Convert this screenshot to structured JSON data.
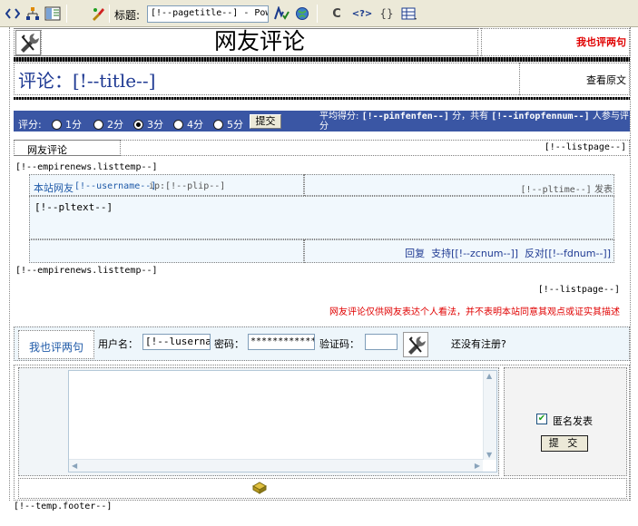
{
  "toolbar": {
    "title_label": "标题:",
    "title_value": "[!--pagetitle--] - Powere",
    "icons": [
      "code-view-icon",
      "tree-icon",
      "layout-icon",
      "paint-icon",
      "validate-icon",
      "globe-icon",
      "refresh-icon",
      "tag-icon",
      "braces-icon",
      "table-icon"
    ],
    "refresh_glyph": "C",
    "tag_glyph": "<?>",
    "braces_glyph": "{}"
  },
  "header": {
    "heading": "网友评论",
    "post_link": "我也评两句"
  },
  "title_row": {
    "comment_title": "评论：[!--title--]",
    "view_original": "查看原文"
  },
  "rating": {
    "label": "评分:",
    "options": [
      {
        "label": "1分",
        "selected": false
      },
      {
        "label": "2分",
        "selected": false
      },
      {
        "label": "3分",
        "selected": true
      },
      {
        "label": "4分",
        "selected": false
      },
      {
        "label": "5分",
        "selected": false
      }
    ],
    "submit_label": "提交",
    "avg_prefix": "平均得分:",
    "avg_value": "[!--pinfenfen--]",
    "avg_middle": "分，共有",
    "count_value": "[!--infopfennum--]",
    "avg_suffix": "人参与评分"
  },
  "list_header": {
    "label": "网友评论",
    "listpage": "[!--listpage--]"
  },
  "listtemp": {
    "start": "[!--empirenews.listtemp--]",
    "end": "[!--empirenews.listtemp--]",
    "comment": {
      "user_label": "本站网友",
      "username": "[!--username--]",
      "ip": "ip:[!--plip--]",
      "time": "[!--pltime--]",
      "time_suffix": "发表",
      "text": "[!--pltext--]",
      "reply": "回复",
      "support": "支持[[!--zcnum--]]",
      "oppose": "反对[[!--fdnum--]]"
    }
  },
  "listpage_bottom": "[!--listpage--]",
  "disclaimer": "网友评论仅供网友表达个人看法，并不表明本站同意其观点或证实其描述",
  "form": {
    "post_link": "我也评两句",
    "username_label": "用户名：",
    "username_value": "[!--lusername--]",
    "password_label": "密码：",
    "password_value": "************",
    "code_label": "验证码：",
    "register_label": "还没有注册?",
    "anonymous_label": "匿名发表",
    "anonymous_checked": true,
    "submit_label": "提 交"
  },
  "footer": "[!--temp.footer--]",
  "colors": {
    "accent_blue": "#3a56a4",
    "link_red": "#e00000",
    "text_blue": "#1f3a93"
  }
}
